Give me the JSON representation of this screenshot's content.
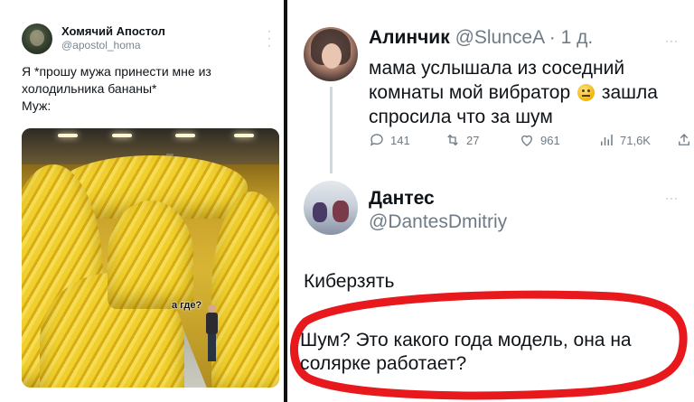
{
  "left_tweet": {
    "author_name": "Хомячий Апостол",
    "author_handle": "@apostol_homa",
    "menu_icon": "more-vertical-icon",
    "text_lines": [
      "Я *прошу мужа принести мне из",
      "холодильника бананы*",
      "Муж:"
    ],
    "image_caption": "а где?"
  },
  "right_tweet": {
    "author_name": "Алинчик",
    "author_handle": "@SlunceA",
    "time": "· 1 д.",
    "text_lines": [
      "мама услышала из соседний",
      "комнаты мой вибратор",
      "спросила что за шум"
    ],
    "emoji_after_line2": "neutral-face-emoji",
    "text_line2_tail": "зашла",
    "actions": {
      "reply_count": "141",
      "retweet_count": "27",
      "like_count": "961",
      "views_count": "71,6K"
    }
  },
  "reply_tweet": {
    "author_name": "Дантес",
    "author_handle": "@DantesDmitriy",
    "label": "Киберзять",
    "reply_lines": [
      "Шум? Это какого года модель, она на",
      "солярке работает?"
    ],
    "highlight_color": "#e8191c"
  }
}
